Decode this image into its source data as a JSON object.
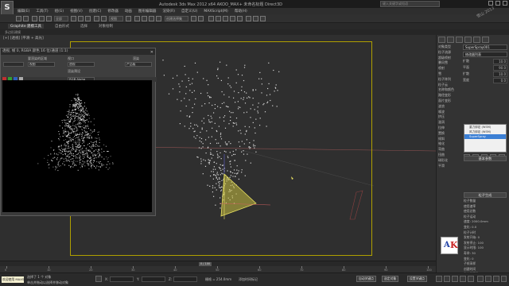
{
  "title_bar": {
    "logo_text": "S",
    "title": "Autodesk 3ds Max 2012 x64    AKOO_MAX+    未命名标题    Direct3D",
    "search_placeholder": "键入关键字或短语",
    "watermark": "雪山 2013"
  },
  "menu": [
    "编辑(E)",
    "工具(T)",
    "组(G)",
    "视图(V)",
    "创建(C)",
    "修改器",
    "动画",
    "图形编辑器",
    "渲染(R)",
    "自定义(U)",
    "MAXScript(M)",
    "帮助(H)"
  ],
  "toolbar": {
    "selection_dropdown": "全部",
    "view_dropdown": "视图",
    "named_sel": "创建选择集"
  },
  "ribbon": {
    "tabs": [
      "Graphite 建模工具",
      "自由形式",
      "选择",
      "对象绘制"
    ],
    "active_tab": "Graphite 建模工具",
    "sub_label": "多边形建模"
  },
  "viewport": {
    "label": "[+] [透视] [平滑 + 高光]",
    "colors": {
      "frame": "#b0a000",
      "particles": "#d8d8d8",
      "emitter": "#d8d050",
      "grid": "#8a5050"
    }
  },
  "render_window": {
    "title": "透视, 帧 0, RGBA 颜色 16 位/通道 (1:1)",
    "close_icon": "close-icon",
    "area_label": "要渲染的区域",
    "area_value": "视图",
    "viewport_label": "视口",
    "viewport_value": "透视",
    "preset_label": "渲染预设",
    "preset_value": "",
    "render_button": "渲染",
    "production_value": "产品级",
    "channel_value": "RGB Alpha"
  },
  "command_panel": {
    "left_items": [
      "对象类型",
      "粒子流源",
      "超级喷射",
      "暴风雪",
      "喷射",
      "雪",
      "粒子阵列",
      "粒子云",
      "名称和颜色",
      "路径变形",
      "面片变形",
      "波浪",
      "噪波",
      "挤压",
      "漩涡",
      "拉伸",
      "置换",
      "倾斜",
      "锥化",
      "弯曲",
      "扭曲",
      "球形化",
      "平滑"
    ],
    "object_name": "SuperSpray001",
    "modifier_list": "修改器列表",
    "rows": [
      {
        "label": "扩散",
        "value": "10.0"
      },
      {
        "label": "平面",
        "value": "90.0"
      },
      {
        "label": "扩散",
        "value": "10.0"
      },
      {
        "label": "宽度",
        "value": "0.0"
      }
    ],
    "stack": [
      "重力绑定 (WSM)",
      "风力绑定 (WSM)",
      "SuperSpray"
    ],
    "stack_selected": 2,
    "rollouts": [
      "基本参数",
      "粒子生成"
    ],
    "params": [
      "粒子数量",
      "使用速率",
      "使用总数",
      "粒子运动",
      "速度: 2000.0mm",
      "变化: 0.0",
      "粒子计时",
      "发射开始: 0",
      "发射停止: 100",
      "显示时限: 100",
      "寿命: 30",
      "变化: 0",
      "子帧采样",
      "创建时间",
      "发射器平移",
      "发射器旋转",
      "粒子大小",
      "大小: 1.0",
      "变化: 0.0"
    ],
    "logo_a": "A",
    "logo_k": "K"
  },
  "timeline": {
    "thumb_label": "0 / 100",
    "ticks": [
      "0",
      "10",
      "20",
      "30",
      "40",
      "50",
      "60",
      "70",
      "80",
      "90",
      "100"
    ]
  },
  "status_bar": {
    "maxscript": "欢迎使用 MAXScri",
    "selected": "选择了 1 个 对象",
    "hint": "单击并拖动以选择并移动对象",
    "x_label": "X:",
    "y_label": "Y:",
    "z_label": "Z:",
    "grid": "栅格 = 254.0mm",
    "auto_key": "自动关键点",
    "set_key": "设置关键点",
    "selected_obj": "选定对象",
    "add_time_tag": "添加时间标记",
    "key_filters": "关键点过滤器..."
  }
}
